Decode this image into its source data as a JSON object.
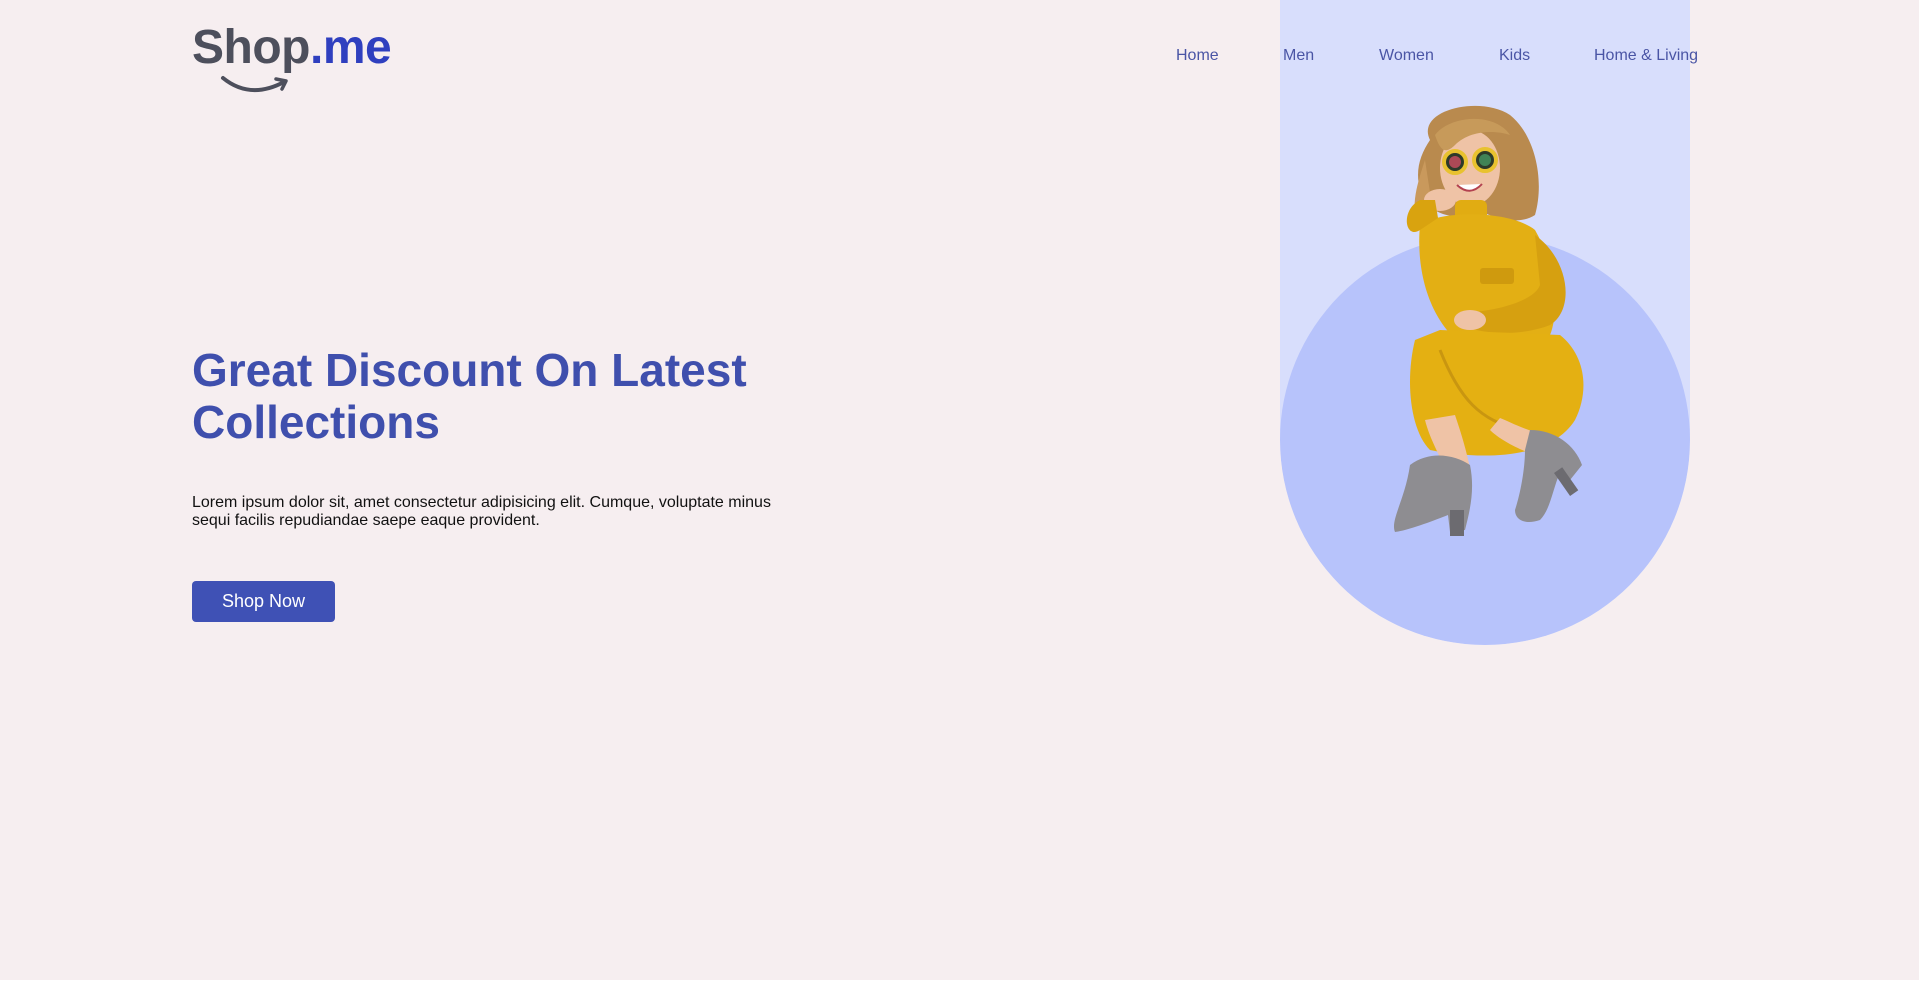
{
  "brand": {
    "name_part1": "Shop",
    "name_part2": ".me"
  },
  "nav": {
    "items": [
      {
        "label": "Home"
      },
      {
        "label": "Men"
      },
      {
        "label": "Women"
      },
      {
        "label": "Kids"
      },
      {
        "label": "Home & Living"
      }
    ]
  },
  "hero": {
    "title": "Great Discount On Latest Collections",
    "description": "Lorem ipsum dolor sit, amet consectetur adipisicing elit. Cumque, voluptate minus sequi facilis repudiandae saepe eaque provident.",
    "cta_label": "Shop Now"
  },
  "colors": {
    "background": "#f6eef0",
    "accent": "#3f51b5",
    "heading": "#3f4fad",
    "nav_text": "#4a55a5",
    "band": "#d8defc",
    "circle": "#b7c3fb"
  },
  "icons": {
    "logo_smile": "smile-arrow-icon",
    "hero_image": "woman-in-yellow-dress-image"
  }
}
